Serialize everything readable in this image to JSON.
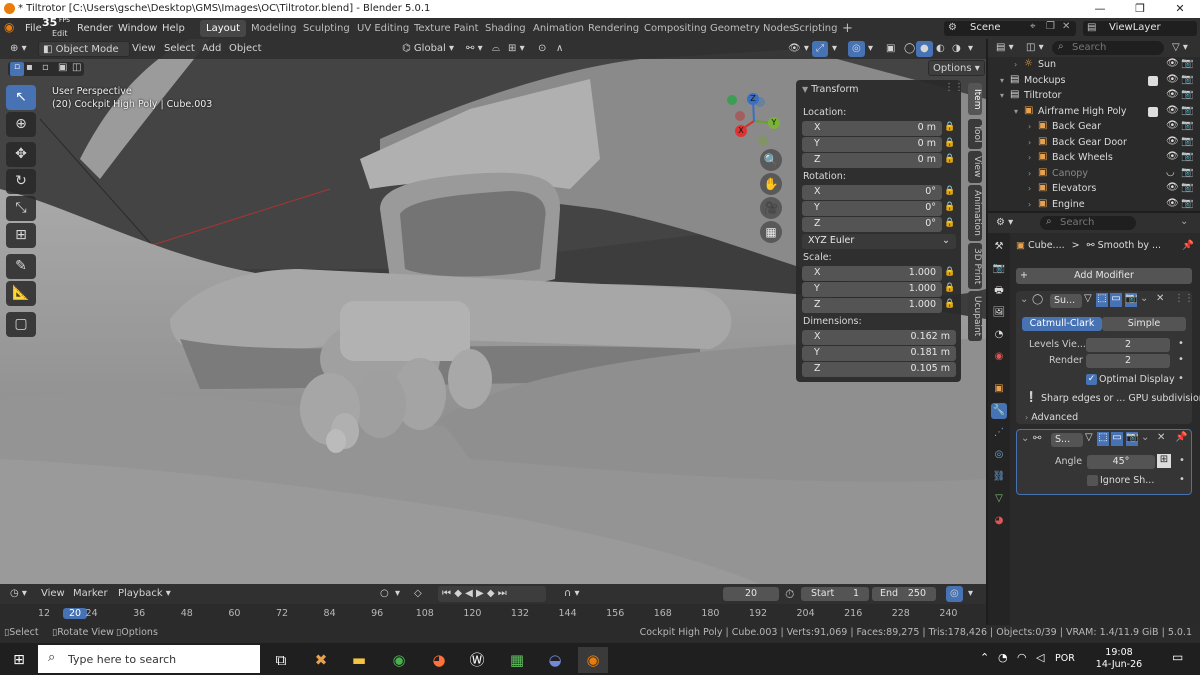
{
  "window": {
    "title": "* Tiltrotor [C:\\Users\\gsche\\Desktop\\GMS\\Images\\OC\\Tiltrotor.blend] - Blender 5.0.1",
    "fps": "35",
    "fps_unit": "FPS",
    "min": "—",
    "max": "❐",
    "close": "✕"
  },
  "menu": {
    "file": "File",
    "edit": "Edit",
    "render": "Render",
    "window": "Window",
    "help": "Help"
  },
  "workspaces": [
    "Layout",
    "Modeling",
    "Sculpting",
    "UV Editing",
    "Texture Paint",
    "Shading",
    "Animation",
    "Rendering",
    "Compositing",
    "Geometry Nodes",
    "Scripting"
  ],
  "add_workspace": "+",
  "scene": {
    "label": "Scene",
    "view_layer": "ViewLayer"
  },
  "viewport_header": {
    "mode": "Object Mode",
    "view": "View",
    "select": "Select",
    "add": "Add",
    "object": "Object",
    "orientation": "Global",
    "options": "Options"
  },
  "viewport_overlay": {
    "perspective": "User Perspective",
    "object_info": "(20) Cockpit High Poly | Cube.003"
  },
  "gizmo": {
    "x": "X",
    "y": "Y",
    "z": "Z"
  },
  "transform_panel": {
    "title": "Transform",
    "location_label": "Location:",
    "location": [
      {
        "k": "X",
        "v": "0 m"
      },
      {
        "k": "Y",
        "v": "0 m"
      },
      {
        "k": "Z",
        "v": "0 m"
      }
    ],
    "rotation_label": "Rotation:",
    "rotation": [
      {
        "k": "X",
        "v": "0°"
      },
      {
        "k": "Y",
        "v": "0°"
      },
      {
        "k": "Z",
        "v": "0°"
      }
    ],
    "rotation_mode": "XYZ Euler",
    "scale_label": "Scale:",
    "scale": [
      {
        "k": "X",
        "v": "1.000"
      },
      {
        "k": "Y",
        "v": "1.000"
      },
      {
        "k": "Z",
        "v": "1.000"
      }
    ],
    "dimensions_label": "Dimensions:",
    "dimensions": [
      {
        "k": "X",
        "v": "0.162 m"
      },
      {
        "k": "Y",
        "v": "0.181 m"
      },
      {
        "k": "Z",
        "v": "0.105 m"
      }
    ]
  },
  "sidebar_tabs": [
    "Item",
    "Tool",
    "View",
    "Animation",
    "3D Print",
    "Ucupaint"
  ],
  "timeline": {
    "view": "View",
    "marker": "Marker",
    "playback": "Playback",
    "current_frame": "20",
    "start_label": "Start",
    "start": "1",
    "end_label": "End",
    "end": "250",
    "frame_ticks": [
      "12",
      "20",
      "24",
      "36",
      "48",
      "60",
      "72",
      "84",
      "96",
      "108",
      "120",
      "132",
      "144",
      "156",
      "168",
      "180",
      "192",
      "204",
      "216",
      "228",
      "240"
    ]
  },
  "status": {
    "select": "Select",
    "rotate": "Rotate View",
    "options": "Options",
    "info": "Cockpit High Poly | Cube.003 | Verts:91,069 | Faces:89,275 | Tris:178,426 | Objects:0/39 | VRAM: 1.4/11.9 GiB | 5.0.1"
  },
  "outliner": {
    "search_placeholder": "Search",
    "rows": [
      {
        "name": "Sun",
        "depth": 2,
        "dim": false
      },
      {
        "name": "Mockups",
        "depth": 1,
        "dim": false
      },
      {
        "name": "Tiltrotor",
        "depth": 1,
        "dim": false
      },
      {
        "name": "Airframe High Poly",
        "depth": 2,
        "dim": false
      },
      {
        "name": "Back Gear",
        "depth": 3,
        "dim": false
      },
      {
        "name": "Back Gear Door",
        "depth": 3,
        "dim": false
      },
      {
        "name": "Back Wheels",
        "depth": 3,
        "dim": false
      },
      {
        "name": "Canopy",
        "depth": 3,
        "dim": true
      },
      {
        "name": "Elevators",
        "depth": 3,
        "dim": false
      },
      {
        "name": "Engine",
        "depth": 3,
        "dim": false
      }
    ]
  },
  "properties": {
    "search_placeholder": "Search",
    "breadcrumb_object": "Cube....",
    "breadcrumb_sep": ">",
    "breadcrumb_modifier": "Smooth by ...",
    "add_modifier": "Add Modifier",
    "subsurf": {
      "name": "Su...",
      "catmull_clark": "Catmull-Clark",
      "simple": "Simple",
      "levels_label": "Levels Vie...",
      "levels": "2",
      "render_label": "Render",
      "render": "2",
      "optimal_display": "Optimal Display",
      "warning": "Sharp edges or ... GPU subdivision",
      "advanced": "Advanced"
    },
    "smooth": {
      "name": "S...",
      "angle_label": "Angle",
      "angle": "45°",
      "ignore_sharp": "Ignore Sh..."
    }
  },
  "taskbar": {
    "search_placeholder": "Type here to search",
    "lang": "POR",
    "time": "19:08",
    "date": "14-Jun-26"
  }
}
